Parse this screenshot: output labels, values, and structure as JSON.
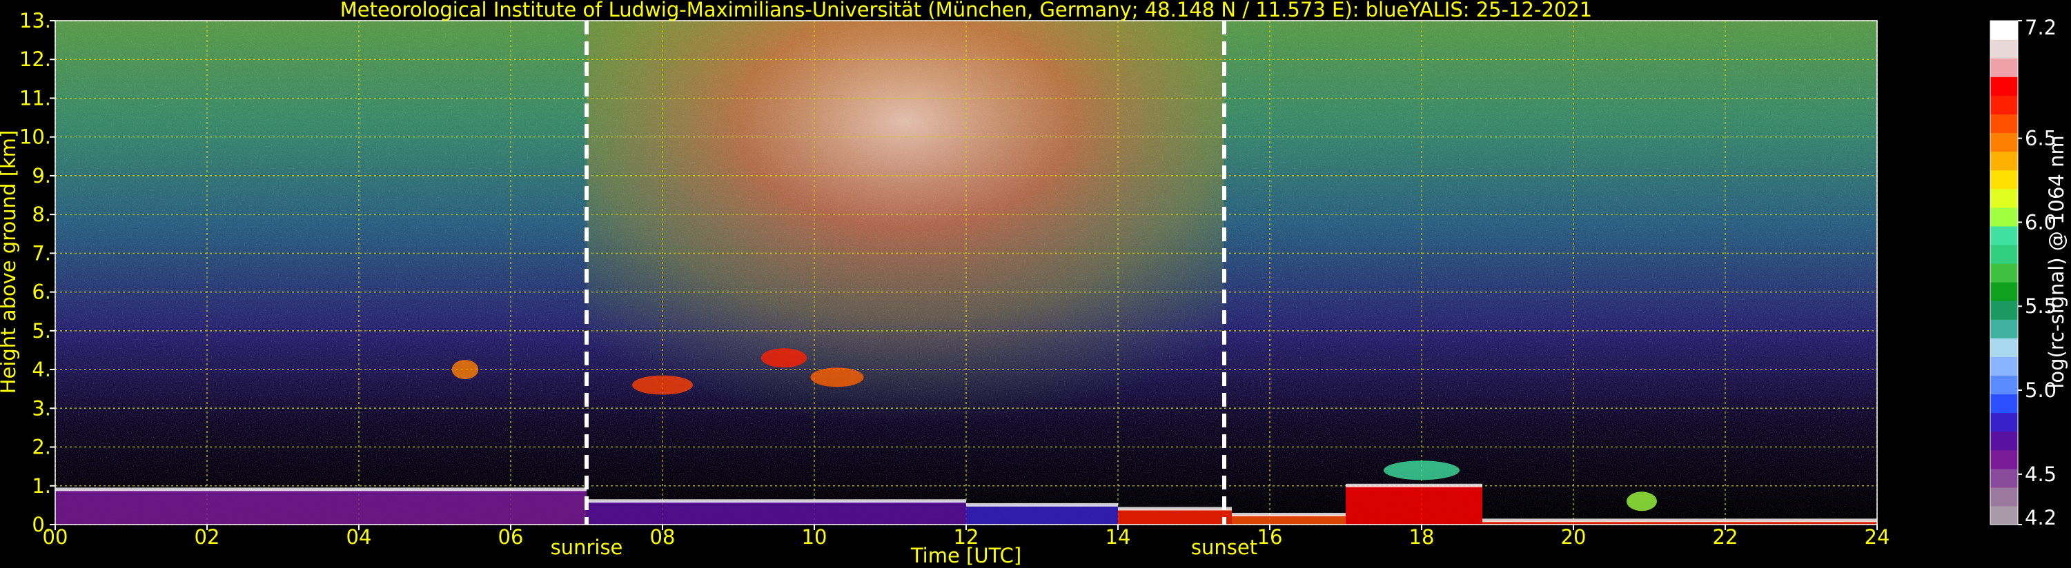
{
  "chart_data": {
    "type": "heatmap",
    "title": "Meteorological Institute of Ludwig-Maximilians-Universität (München, Germany; 48.148 N / 11.573 E):     blueYALIS: 25-12-2021",
    "xlabel": "Time [UTC]",
    "ylabel": "Height above ground [km]",
    "xlim": [
      0,
      24
    ],
    "ylim": [
      0,
      13
    ],
    "x_ticks": [
      "00",
      "02",
      "04",
      "06",
      "08",
      "10",
      "12",
      "14",
      "16",
      "18",
      "20",
      "22",
      "24"
    ],
    "y_ticks": [
      "0.",
      "1.",
      "2.",
      "3.",
      "4.",
      "5.",
      "6.",
      "7.",
      "8.",
      "9.",
      "10.",
      "11.",
      "12.",
      "13."
    ],
    "grid": true,
    "markers": [
      {
        "label": "sunrise",
        "x": 7.0
      },
      {
        "label": "sunset",
        "x": 15.4
      }
    ],
    "colorbar": {
      "label": "log(rc-signal) @ 1064 nm",
      "range": [
        4.2,
        7.2
      ],
      "tick_values": [
        4.2,
        4.5,
        5.0,
        5.5,
        6.0,
        6.5,
        7.2
      ],
      "tick_labels": [
        "4.2",
        "4.5",
        "5.0",
        "5.5",
        "6.0",
        "6.5",
        "7.2"
      ],
      "colors": [
        "#a89aa8",
        "#9c7aa0",
        "#8a4a9c",
        "#7a1a96",
        "#5a10a0",
        "#3a20c8",
        "#2a50ff",
        "#5a8cff",
        "#8ab4ff",
        "#a8d8ee",
        "#40b0a0",
        "#1a9a60",
        "#10a020",
        "#40c040",
        "#30d080",
        "#40e0a0",
        "#a0ff40",
        "#e0ff20",
        "#ffe000",
        "#ffb000",
        "#ff8000",
        "#ff5000",
        "#ff2000",
        "#ff0000",
        "#f0a0a8",
        "#e8d8d8",
        "#ffffff"
      ]
    }
  },
  "colors": {
    "background": "#000000",
    "text": "#ffff00",
    "grid": "#d0d000",
    "marker": "#ffffff"
  }
}
